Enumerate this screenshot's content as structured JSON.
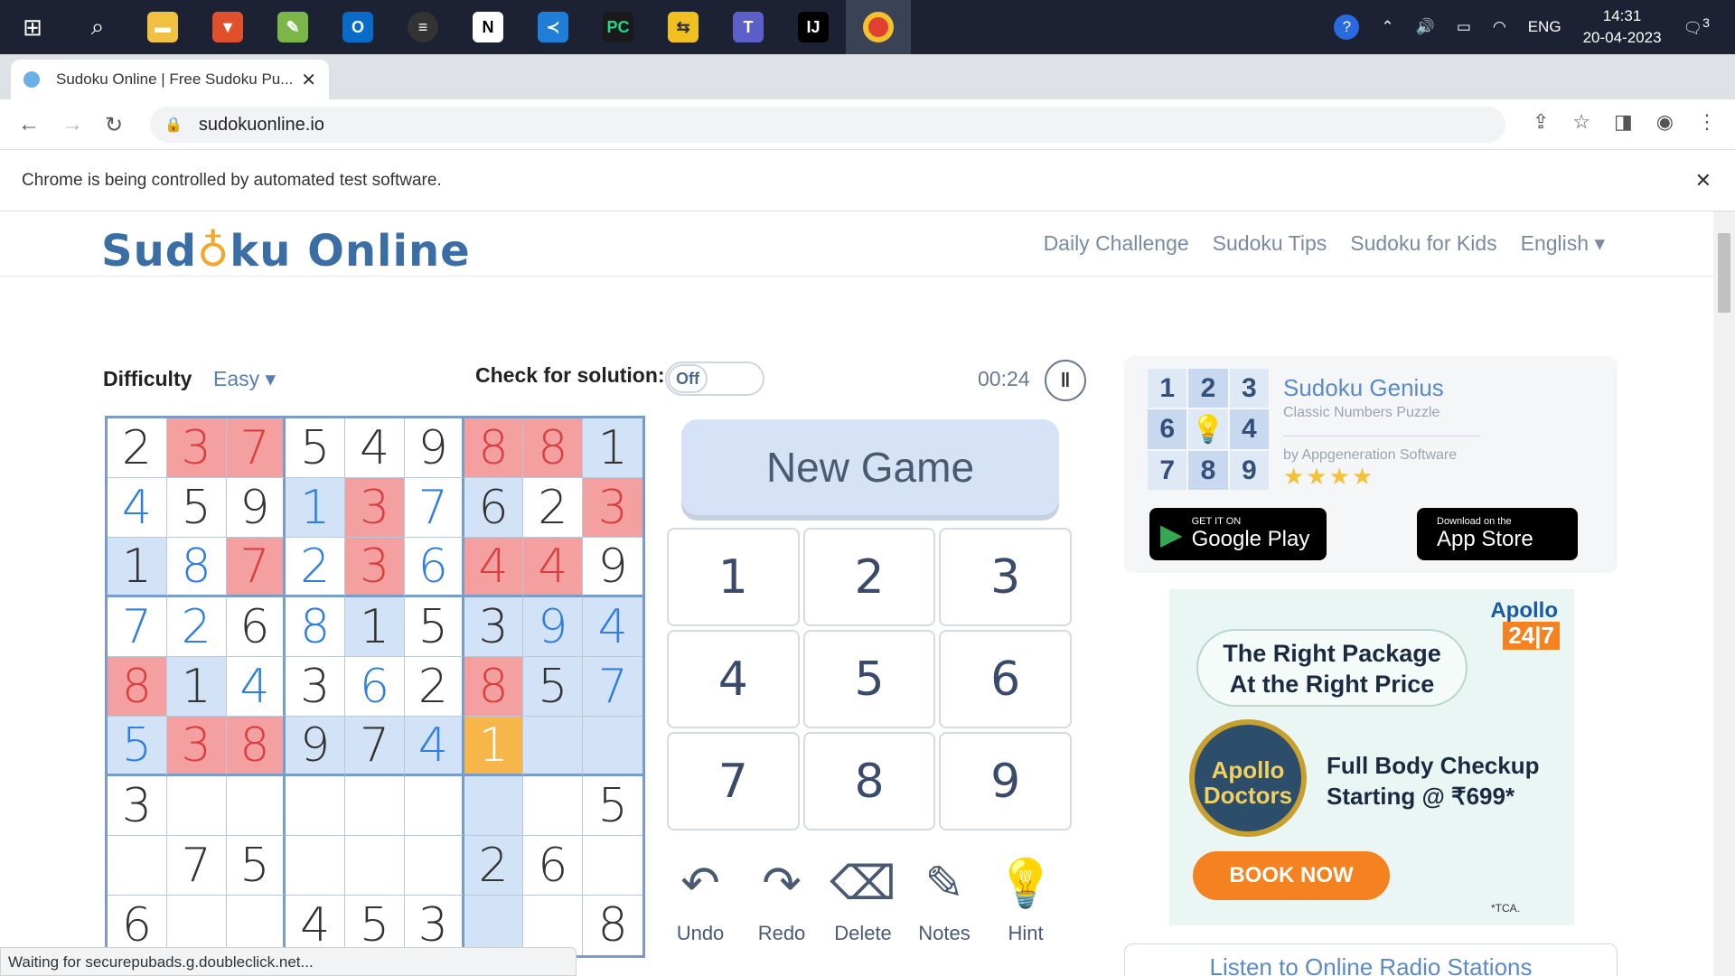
{
  "taskbar": {
    "apps": [
      "windows-icon",
      "search-icon",
      "file-explorer-icon",
      "brave-icon",
      "notepadpp-icon",
      "outlook-icon",
      "media-icon",
      "notion-icon",
      "vscode-icon",
      "pycharm-icon",
      "git-icon",
      "teams-icon",
      "intellij-icon",
      "chrome-icon"
    ],
    "lang": "ENG",
    "time": "14:31",
    "date": "20-04-2023",
    "notif_count": "3"
  },
  "browser": {
    "tab_title": "Sudoku Online | Free Sudoku Pu...",
    "url": "sudokuonline.io",
    "info_message": "Chrome is being controlled by automated test software.",
    "status_text": "Waiting for securepubads.g.doubleclick.net..."
  },
  "site": {
    "logo_left": "Sud",
    "logo_right": "ku Online",
    "nav": [
      "Daily Challenge",
      "Sudoku Tips",
      "Sudoku for Kids",
      "English ▾"
    ]
  },
  "game": {
    "difficulty_label": "Difficulty",
    "difficulty_value": "Easy ▾",
    "check_label": "Check for solution:",
    "toggle_state": "Off",
    "timer": "00:24",
    "new_game": "New Game",
    "numpad": [
      "1",
      "2",
      "3",
      "4",
      "5",
      "6",
      "7",
      "8",
      "9"
    ],
    "tools": [
      {
        "label": "Undo",
        "icon": "undo-icon",
        "glyph": "↶"
      },
      {
        "label": "Redo",
        "icon": "redo-icon",
        "glyph": "↷"
      },
      {
        "label": "Delete",
        "icon": "eraser-icon",
        "glyph": "⌫"
      },
      {
        "label": "Notes",
        "icon": "pencil-icon",
        "glyph": "✎"
      },
      {
        "label": "Hint",
        "icon": "lightbulb-icon",
        "glyph": "💡"
      }
    ],
    "grid": [
      [
        [
          "2",
          "g"
        ],
        [
          "3",
          "e"
        ],
        [
          "7",
          "e"
        ],
        [
          "5",
          "g"
        ],
        [
          "4",
          "g"
        ],
        [
          "9",
          "g"
        ],
        [
          "8",
          "e"
        ],
        [
          "8",
          "e"
        ],
        [
          "1",
          "h"
        ]
      ],
      [
        [
          "4",
          "b"
        ],
        [
          "5",
          "g"
        ],
        [
          "9",
          "g"
        ],
        [
          "1",
          "bh"
        ],
        [
          "3",
          "e"
        ],
        [
          "7",
          "b"
        ],
        [
          "6",
          "h"
        ],
        [
          "2",
          "g"
        ],
        [
          "3",
          "e"
        ]
      ],
      [
        [
          "1",
          "h"
        ],
        [
          "8",
          "b"
        ],
        [
          "7",
          "e"
        ],
        [
          "2",
          "b"
        ],
        [
          "3",
          "e"
        ],
        [
          "6",
          "b"
        ],
        [
          "4",
          "e"
        ],
        [
          "4",
          "e"
        ],
        [
          "9",
          "g"
        ]
      ],
      [
        [
          "7",
          "b"
        ],
        [
          "2",
          "b"
        ],
        [
          "6",
          "g"
        ],
        [
          "8",
          "b"
        ],
        [
          "1",
          "h"
        ],
        [
          "5",
          "g"
        ],
        [
          "3",
          "h"
        ],
        [
          "9",
          "bh"
        ],
        [
          "4",
          "bh"
        ]
      ],
      [
        [
          "8",
          "e"
        ],
        [
          "1",
          "h"
        ],
        [
          "4",
          "b"
        ],
        [
          "3",
          "g"
        ],
        [
          "6",
          "b"
        ],
        [
          "2",
          "g"
        ],
        [
          "8",
          "e"
        ],
        [
          "5",
          "h"
        ],
        [
          "7",
          "bh"
        ]
      ],
      [
        [
          "5",
          "bh"
        ],
        [
          "3",
          "e"
        ],
        [
          "8",
          "e"
        ],
        [
          "9",
          "h"
        ],
        [
          "7",
          "h"
        ],
        [
          "4",
          "bh"
        ],
        [
          "1",
          "s"
        ],
        [
          "",
          "h"
        ],
        [
          "",
          "h"
        ]
      ],
      [
        [
          "3",
          "g"
        ],
        [
          "",
          ""
        ],
        [
          "",
          ""
        ],
        [
          "",
          ""
        ],
        [
          "",
          ""
        ],
        [
          "",
          ""
        ],
        [
          "",
          "h"
        ],
        [
          "",
          ""
        ],
        [
          "5",
          "g"
        ]
      ],
      [
        [
          "",
          ""
        ],
        [
          "7",
          "g"
        ],
        [
          "5",
          "g"
        ],
        [
          "",
          ""
        ],
        [
          "",
          ""
        ],
        [
          "",
          ""
        ],
        [
          "2",
          "h"
        ],
        [
          "6",
          "g"
        ],
        [
          "",
          ""
        ]
      ],
      [
        [
          "6",
          "g"
        ],
        [
          "",
          ""
        ],
        [
          "",
          ""
        ],
        [
          "4",
          "g"
        ],
        [
          "5",
          "g"
        ],
        [
          "3",
          "g"
        ],
        [
          "",
          "h"
        ],
        [
          "",
          ""
        ],
        [
          "8",
          "g"
        ]
      ]
    ]
  },
  "promo": {
    "grid": [
      "1",
      "2",
      "3",
      "6",
      "💡",
      "4",
      "7",
      "8",
      "9"
    ],
    "app_name": "Sudoku Genius",
    "app_sub": "Classic Numbers Puzzle",
    "app_by": "by Appgeneration Software",
    "stars": "★★★★",
    "google_small": "GET IT ON",
    "google_large": "Google Play",
    "apple_small": "Download on the",
    "apple_large": "App Store"
  },
  "ad": {
    "brand": "Apollo",
    "brand_tag": "24|7",
    "headline_1": "The Right Package",
    "headline_2": "At the Right Price",
    "badge_1": "Apollo",
    "badge_2": "Doctors",
    "offer_1": "Full Body Checkup",
    "offer_2": "Starting @ ₹699*",
    "cta": "BOOK NOW",
    "fine_print": "*TCA."
  },
  "radio": "Listen to Online Radio Stations"
}
